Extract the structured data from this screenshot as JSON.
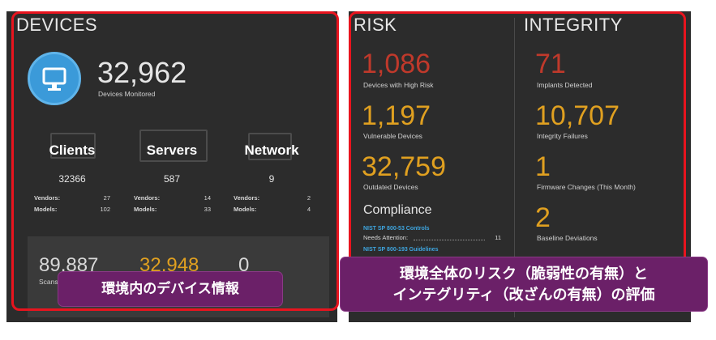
{
  "devices": {
    "title": "DEVICES",
    "total": "32,962",
    "total_label": "Devices Monitored",
    "categories": [
      {
        "name": "Clients",
        "count": "32366",
        "vendors_label": "Vendors:",
        "vendors": "27",
        "models_label": "Models:",
        "models": "102"
      },
      {
        "name": "Servers",
        "count": "587",
        "vendors_label": "Vendors:",
        "vendors": "14",
        "models_label": "Models:",
        "models": "33"
      },
      {
        "name": "Network",
        "count": "9",
        "vendors_label": "Vendors:",
        "vendors": "2",
        "models_label": "Models:",
        "models": "4"
      }
    ],
    "bottom": [
      {
        "value": "89,887",
        "label": "Scans"
      },
      {
        "value": "32,948",
        "label": ""
      },
      {
        "value": "0",
        "label": ""
      }
    ]
  },
  "risk": {
    "title": "RISK",
    "metrics": [
      {
        "value": "1,086",
        "label": "Devices with High Risk"
      },
      {
        "value": "1,197",
        "label": "Vulnerable Devices"
      },
      {
        "value": "32,759",
        "label": "Outdated Devices"
      }
    ],
    "compliance_title": "Compliance",
    "compliance": [
      {
        "name": "NIST SP 800-53 Controls",
        "attention_label": "Needs Attention:",
        "attention_value": "11"
      },
      {
        "name": "NIST SP 800-193 Guidelines"
      }
    ]
  },
  "integrity": {
    "title": "INTEGRITY",
    "metrics": [
      {
        "value": "71",
        "label": "Implants Detected"
      },
      {
        "value": "10,707",
        "label": "Integrity Failures"
      },
      {
        "value": "1",
        "label": "Firmware Changes (This Month)"
      },
      {
        "value": "2",
        "label": "Baseline Deviations"
      }
    ]
  },
  "callouts": {
    "left": "環境内のデバイス情報",
    "right_line1": "環境全体のリスク（脆弱性の有無）と",
    "right_line2": "インテグリティ（改ざんの有無）の評価"
  },
  "colors": {
    "red": "#c0392b",
    "orange": "#e0a020",
    "blue_circle": "#3b9ad9",
    "highlight_border": "#e8141e",
    "callout_bg": "#6b2068"
  }
}
